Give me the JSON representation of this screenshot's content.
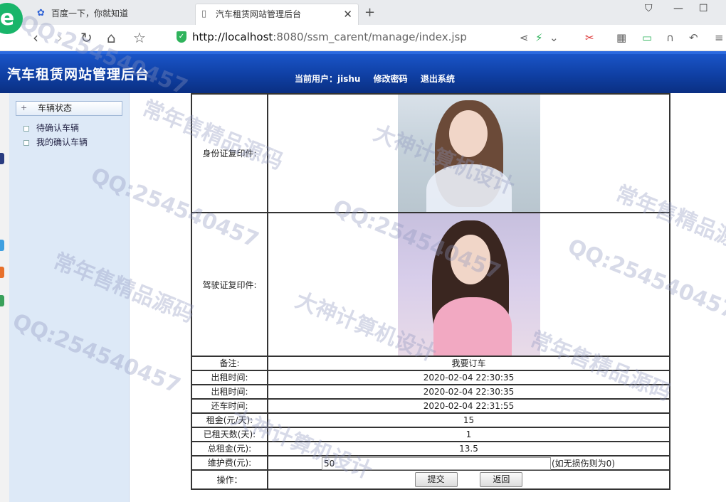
{
  "browser": {
    "tabs": [
      {
        "label": "百度一下，你就知道"
      },
      {
        "label": "汽车租赁网站管理后台"
      }
    ],
    "url_host": "http://localhost",
    "url_rest": ":8080/ssm_carent/manage/index.jsp",
    "logo": "e"
  },
  "header": {
    "title": "汽车租赁网站管理后台",
    "current_user_label": "当前用户：jishu",
    "change_password": "修改密码",
    "logout": "退出系统"
  },
  "sidebar": {
    "group": "车辆状态",
    "items": [
      {
        "label": "待确认车辆"
      },
      {
        "label": "我的确认车辆"
      }
    ]
  },
  "detail": {
    "id_copy_label": "身份证复印件:",
    "license_copy_label": "驾驶证复印件:",
    "rows": [
      {
        "label": "备注:",
        "value": "我要订车"
      },
      {
        "label": "出租时间:",
        "value": "2020-02-04 22:30:35"
      },
      {
        "label": "出租时间:",
        "value": "2020-02-04 22:30:35"
      },
      {
        "label": "还车时间:",
        "value": "2020-02-04 22:31:55"
      },
      {
        "label": "租金(元/天):",
        "value": "15"
      },
      {
        "label": "已租天数(天):",
        "value": "1"
      },
      {
        "label": "总租金(元):",
        "value": "13.5"
      }
    ],
    "maintenance_label": "维护费(元):",
    "maintenance_value": "50",
    "maintenance_hint": "(如无损伤则为0)",
    "operation_label": "操作：",
    "submit": "提交",
    "back": "返回"
  },
  "watermarks": [
    "QQ:254540457",
    "常年售精品源码",
    "大神计算机设计",
    "QQ:254540457",
    "常年售精品源码",
    "QQ:254540457",
    "大神计算机设计",
    "常年售精品源码",
    "QQ:254540457",
    "常年售精品源码",
    "大神计算机设计",
    "QQ:254540457"
  ],
  "colors": {
    "header_blue": "#0f3fa3",
    "sidebar_bg": "#dde9f7",
    "shield_green": "#2fb35c"
  }
}
